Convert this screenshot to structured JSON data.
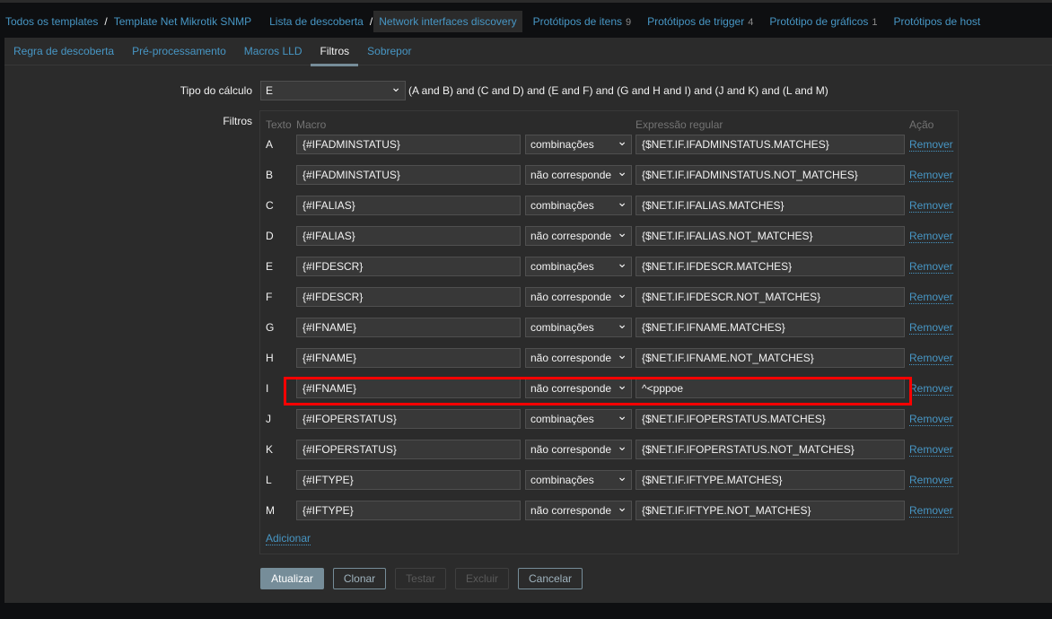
{
  "breadcrumbs": [
    {
      "label": "Todos os templates"
    },
    {
      "label": "Template Net Mikrotik SNMP"
    },
    {
      "label": "Lista de descoberta"
    },
    {
      "label": "Network interfaces discovery"
    },
    {
      "label": "Protótipos de itens",
      "count": "9"
    },
    {
      "label": "Protótipos de trigger",
      "count": "4"
    },
    {
      "label": "Protótipo de gráficos",
      "count": "1"
    },
    {
      "label": "Protótipos de host"
    }
  ],
  "tabs": [
    "Regra de descoberta",
    "Pré-processamento",
    "Macros LLD",
    "Filtros",
    "Sobrepor"
  ],
  "active_tab": "Filtros",
  "calc": {
    "label": "Tipo do cálculo",
    "value": "E",
    "formula": "(A and B) and (C and D) and (E and F) and (G and H and I) and (J and K) and (L and M)"
  },
  "filters": {
    "label": "Filtros",
    "headers": {
      "label": "Texto",
      "macro": "Macro",
      "regex": "Expressão regular",
      "action": "Ação"
    },
    "remove_label": "Remover",
    "add_label": "Adicionar",
    "rows": [
      {
        "id": "A",
        "macro": "{#IFADMINSTATUS}",
        "op": "combinações",
        "regex": "{$NET.IF.IFADMINSTATUS.MATCHES}"
      },
      {
        "id": "B",
        "macro": "{#IFADMINSTATUS}",
        "op": "não corresponde",
        "regex": "{$NET.IF.IFADMINSTATUS.NOT_MATCHES}"
      },
      {
        "id": "C",
        "macro": "{#IFALIAS}",
        "op": "combinações",
        "regex": "{$NET.IF.IFALIAS.MATCHES}"
      },
      {
        "id": "D",
        "macro": "{#IFALIAS}",
        "op": "não corresponde",
        "regex": "{$NET.IF.IFALIAS.NOT_MATCHES}"
      },
      {
        "id": "E",
        "macro": "{#IFDESCR}",
        "op": "combinações",
        "regex": "{$NET.IF.IFDESCR.MATCHES}"
      },
      {
        "id": "F",
        "macro": "{#IFDESCR}",
        "op": "não corresponde",
        "regex": "{$NET.IF.IFDESCR.NOT_MATCHES}"
      },
      {
        "id": "G",
        "macro": "{#IFNAME}",
        "op": "combinações",
        "regex": "{$NET.IF.IFNAME.MATCHES}"
      },
      {
        "id": "H",
        "macro": "{#IFNAME}",
        "op": "não corresponde",
        "regex": "{$NET.IF.IFNAME.NOT_MATCHES}"
      },
      {
        "id": "I",
        "macro": "{#IFNAME}",
        "op": "não corresponde",
        "regex": "^<pppoe"
      },
      {
        "id": "J",
        "macro": "{#IFOPERSTATUS}",
        "op": "combinações",
        "regex": "{$NET.IF.IFOPERSTATUS.MATCHES}"
      },
      {
        "id": "K",
        "macro": "{#IFOPERSTATUS}",
        "op": "não corresponde",
        "regex": "{$NET.IF.IFOPERSTATUS.NOT_MATCHES}"
      },
      {
        "id": "L",
        "macro": "{#IFTYPE}",
        "op": "combinações",
        "regex": "{$NET.IF.IFTYPE.MATCHES}"
      },
      {
        "id": "M",
        "macro": "{#IFTYPE}",
        "op": "não corresponde",
        "regex": "{$NET.IF.IFTYPE.NOT_MATCHES}"
      }
    ]
  },
  "buttons": {
    "update": "Atualizar",
    "clone": "Clonar",
    "test": "Testar",
    "delete": "Excluir",
    "cancel": "Cancelar"
  },
  "highlight_color": "#ff0000"
}
